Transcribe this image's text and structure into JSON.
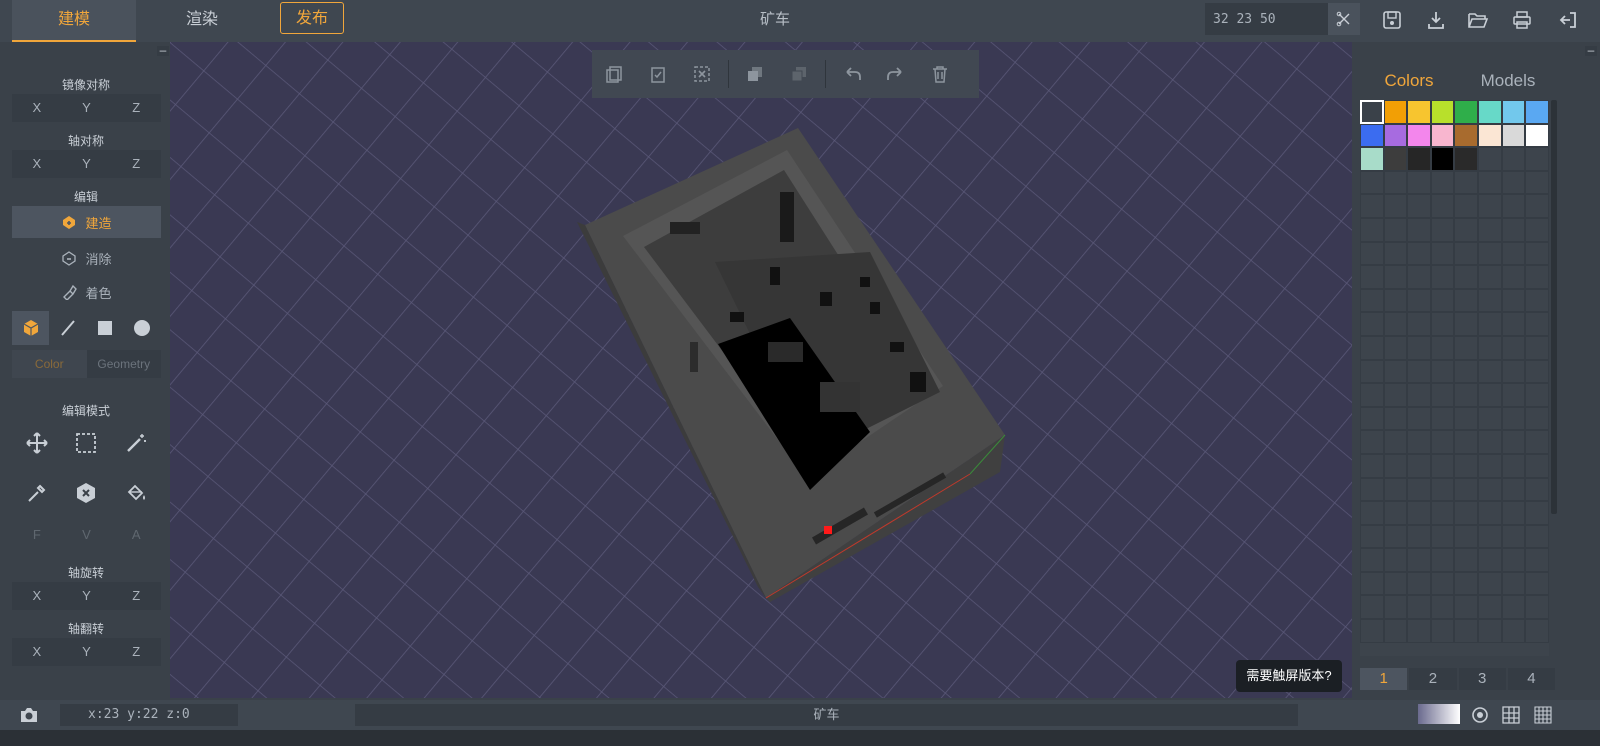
{
  "header": {
    "tabs": [
      {
        "label": "建模",
        "active": true
      },
      {
        "label": "渲染",
        "active": false
      }
    ],
    "publish_label": "发布",
    "doc_title": "矿车",
    "dimensions_value": "32 23 50",
    "icons": [
      "scissors-icon",
      "save-icon",
      "download-icon",
      "folder-open-icon",
      "print-icon",
      "exit-icon"
    ]
  },
  "left_panel": {
    "mirror_title": "镜像对称",
    "axis_sym_title": "轴对称",
    "edit_title": "编辑",
    "axes": [
      "X",
      "Y",
      "Z"
    ],
    "modes": [
      {
        "label": "建造",
        "icon": "build-icon",
        "active": true
      },
      {
        "label": "消除",
        "icon": "erase-icon",
        "active": false
      },
      {
        "label": "着色",
        "icon": "paint-icon",
        "active": false
      }
    ],
    "brush_shapes": [
      "cube-icon",
      "line-icon",
      "square-icon",
      "sphere-icon"
    ],
    "color_tab": "Color",
    "geometry_tab": "Geometry",
    "edit_mode_title": "编辑模式",
    "edit_tools": [
      "move-icon",
      "select-rect-icon",
      "magic-wand-icon",
      "eyedropper-icon",
      "delete-selection-icon",
      "fill-bucket-icon"
    ],
    "fva": [
      "F",
      "V",
      "A"
    ],
    "axis_rotate_title": "轴旋转",
    "axis_flip_title": "轴翻转"
  },
  "toolbar_icons": [
    "copy-icon",
    "paste-icon",
    "clear-selection-icon",
    "duplicate-icon",
    "merge-icon",
    "undo-icon",
    "redo-icon",
    "trash-icon"
  ],
  "viewport": {
    "tooltip": "需要触屏版本?"
  },
  "right_panel": {
    "tabs": [
      {
        "label": "Colors",
        "active": true
      },
      {
        "label": "Models",
        "active": false
      }
    ],
    "palette": [
      "#3a4149",
      "#f29f05",
      "#f7c52f",
      "#b8e02b",
      "#2fae4a",
      "#67d9c8",
      "#72c8ec",
      "#5aa8f2",
      "#3b6cf0",
      "#a76be0",
      "#f386ec",
      "#f8b6cf",
      "#a86b2e",
      "#fbe6d4",
      "#d9d9d9",
      "#ffffff",
      "#a8dcc9",
      "#3d3d3d",
      "#262626",
      "#000000",
      "#2a2a2a"
    ],
    "pages": [
      "1",
      "2",
      "3",
      "4"
    ],
    "current_page": "1"
  },
  "status": {
    "coords": "x:23 y:22 z:0",
    "model_name": "矿车",
    "icons": [
      "camera-icon",
      "gradient-swatch",
      "target-icon",
      "grid-icon",
      "grid-fine-icon"
    ]
  },
  "colors": {
    "accent": "#f0a63b",
    "background": "#3a4149",
    "viewport": "#3a3953"
  }
}
